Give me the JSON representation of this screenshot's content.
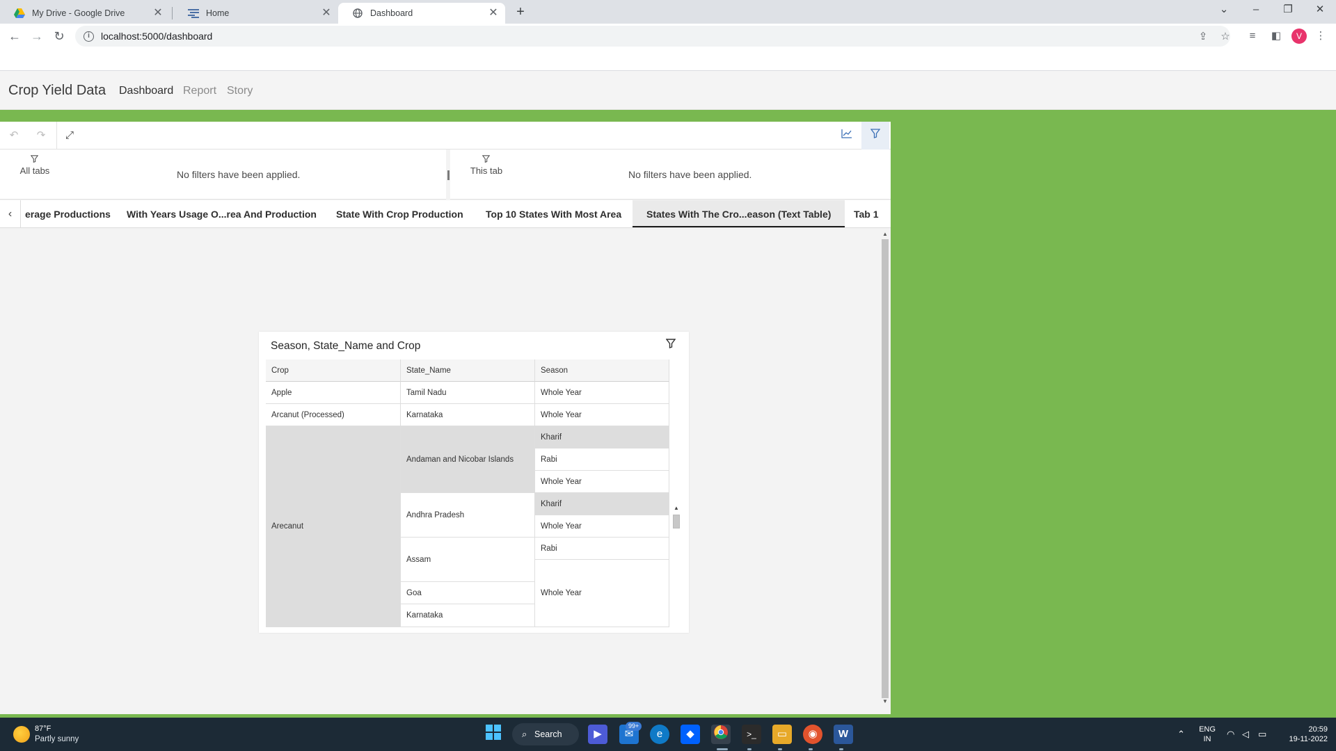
{
  "browser": {
    "tabs": [
      {
        "title": "My Drive - Google Drive",
        "icon": "google-drive-icon"
      },
      {
        "title": "Home",
        "icon": "app-home-icon"
      },
      {
        "title": "Dashboard",
        "icon": "globe-icon"
      }
    ],
    "url": "localhost:5000/dashboard",
    "profile_initial": "V"
  },
  "app": {
    "title": "Crop Yield Data",
    "nav": [
      "Dashboard",
      "Report",
      "Story"
    ],
    "active_nav": "Dashboard"
  },
  "filters": {
    "all_tabs_label": "All tabs",
    "all_tabs_message": "No filters have been applied.",
    "this_tab_label": "This tab",
    "this_tab_message": "No filters have been applied."
  },
  "dashboard_tabs": [
    "erage Productions",
    "With Years Usage O...rea And Production",
    "State With Crop Production",
    "Top 10 States With Most Area",
    "States With The Cro...eason (Text Table)",
    "Tab 1"
  ],
  "active_dashboard_tab": "States With The Cro...eason (Text Table)",
  "widget": {
    "title": "Season, State_Name and Crop",
    "columns": [
      "Crop",
      "State_Name",
      "Season"
    ],
    "crop_cells": [
      "Apple",
      "Arcanut (Processed)",
      "Arecanut"
    ],
    "state_cells": [
      "Tamil Nadu",
      "Karnataka",
      "Andaman and Nicobar Islands",
      "Andhra Pradesh",
      "Assam",
      "Goa",
      "Karnataka"
    ],
    "season_cells": [
      "Whole Year",
      "Whole Year",
      "Kharif",
      "Rabi",
      "Whole Year",
      "Kharif",
      "Whole Year",
      "Rabi",
      "Whole Year"
    ]
  },
  "taskbar": {
    "weather_temp": "87°F",
    "weather_desc": "Partly sunny",
    "search_label": "Search",
    "mail_badge": "99+",
    "lang_line1": "ENG",
    "lang_line2": "IN",
    "time": "20:59",
    "date": "19-11-2022"
  },
  "colors": {
    "accent_green": "#79b850",
    "taskbar": "#1c2a36",
    "profile": "#e8336b",
    "row_highlight": "#dddddd"
  }
}
